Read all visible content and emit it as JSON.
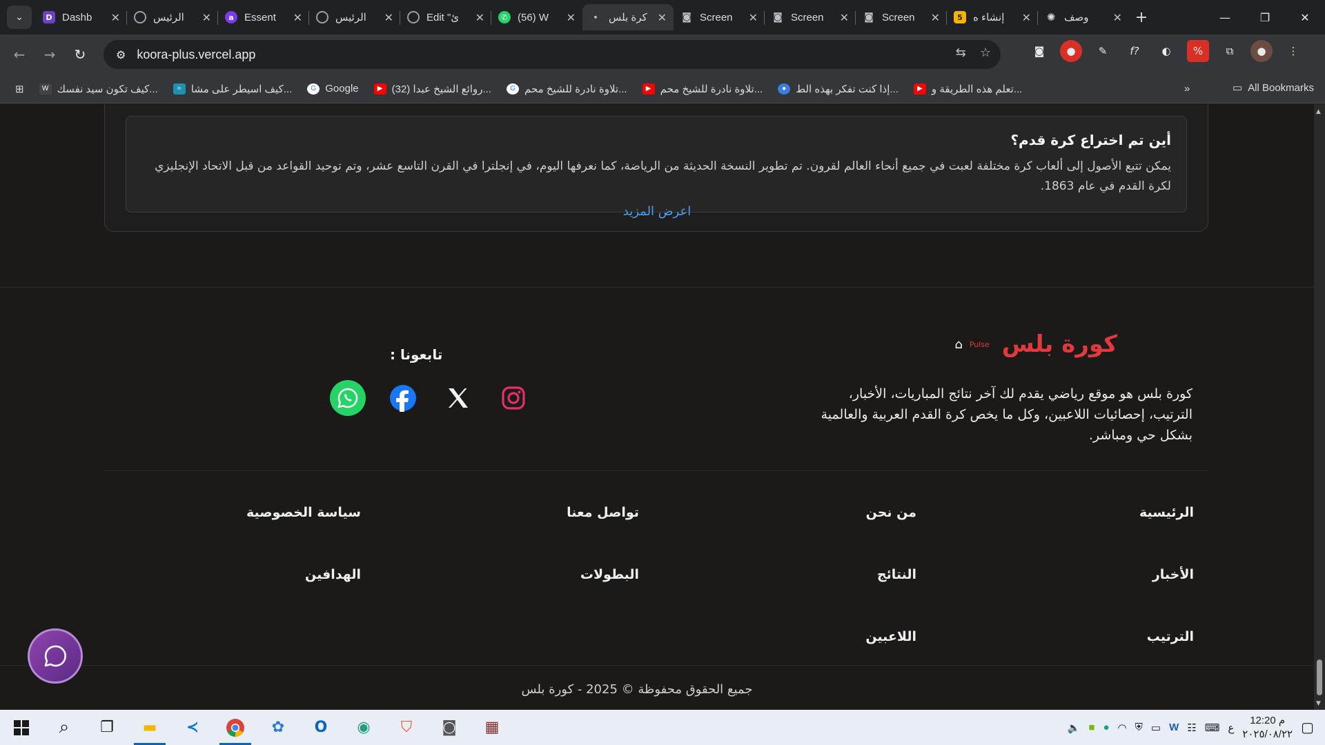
{
  "browser": {
    "tabs": [
      {
        "title": "Dashb",
        "icon": "dashboard-app-icon",
        "color": "#6f42c1"
      },
      {
        "title": "الرئيس",
        "icon": "globe-icon",
        "color": "#5f6368"
      },
      {
        "title": "Essent",
        "icon": "ai-app-icon",
        "color": "#7c3aed"
      },
      {
        "title": "الرئيس",
        "icon": "globe-icon",
        "color": "#5f6368"
      },
      {
        "title": "Edit \"ئ",
        "icon": "globe-icon",
        "color": "#5f6368"
      },
      {
        "title": "(56) W",
        "icon": "whatsapp-icon",
        "color": "#25d366"
      },
      {
        "title": "كرة بلس",
        "icon": "loading-icon",
        "color": "#35363a"
      },
      {
        "title": "Screen",
        "icon": "camera-icon",
        "color": "#5f6368"
      },
      {
        "title": "Screen",
        "icon": "camera-icon",
        "color": "#5f6368"
      },
      {
        "title": "Screen",
        "icon": "camera-icon",
        "color": "#5f6368"
      },
      {
        "title": "إنشاء ه",
        "icon": "five-icon",
        "color": "#f4b400"
      },
      {
        "title": "وصف",
        "icon": "chatgpt-icon",
        "color": "#5f6368"
      }
    ],
    "url": "koora-plus.vercel.app",
    "bookmarks": [
      {
        "title": "كيف تكون سيد نفسك...",
        "color": "#444"
      },
      {
        "title": "كيف اسيطر على مشا...",
        "color": "#1e90b0"
      },
      {
        "title": "Google",
        "color": "#ffffff"
      },
      {
        "title": "(32) روائع الشيخ عبدا...",
        "color": "#ff0000"
      },
      {
        "title": "تلاوة نادرة للشيخ محم...",
        "color": "#ffffff"
      },
      {
        "title": "تلاوة نادرة للشيخ محم...",
        "color": "#ff0000"
      },
      {
        "title": "إذا كنت تفكر بهذه الط...",
        "color": "#3c7ee0"
      },
      {
        "title": "تعلم هذه الطريقة و...",
        "color": "#ff0000"
      }
    ],
    "all_bookmarks": "All Bookmarks"
  },
  "page": {
    "faq": {
      "question": "أين تم اختراع كرة قدم؟",
      "answer": "يمكن تتبع الأصول إلى ألعاب كرة مختلفة لعبت في جميع أنحاء العالم لقرون. تم تطوير النسخة الحديثة من الرياضة، كما نعرفها اليوم، في إنجلترا في القرن التاسع عشر، وتم توحيد القواعد من قبل الاتحاد الإنجليزي لكرة القدم في عام 1863.",
      "show_more": "اعرض المزيد"
    },
    "footer": {
      "brand_name": "كورة بلس",
      "pulse_text": "Pulse",
      "about": "كورة بلس هو موقع رياضي يقدم لك آخر نتائج المباريات، الأخبار، الترتيب، إحصائيات اللاعبين، وكل ما يخص كرة القدم العربية والعالمية بشكل حي ومباشر.",
      "follow_us": "تابعونا :",
      "social": [
        "instagram-icon",
        "x-icon",
        "facebook-icon",
        "whatsapp-icon"
      ],
      "links": {
        "home": "الرئيسية",
        "about": "من نحن",
        "contact": "تواصل معنا",
        "privacy": "سياسة الخصوصية",
        "news": "الأخبار",
        "results": "النتائج",
        "tournaments": "البطولات",
        "scorers": "الهدافين",
        "standings": "الترتيب",
        "players": "اللاعبين"
      },
      "copyright": "جميع الحقوق محفوظة © 2025 - كورة بلس"
    }
  },
  "taskbar": {
    "apps": [
      "start-icon",
      "search-icon",
      "task-view-icon",
      "file-explorer-icon",
      "vscode-icon",
      "chrome-icon",
      "m365-icon",
      "outlook-icon",
      "edge-icon",
      "brave-icon",
      "camera-app-icon",
      "winrar-icon"
    ],
    "lang": "ع",
    "time": "12:20 م",
    "date": "٢٠٢٥/٠٨/٢٢"
  },
  "colors": {
    "accent": "#e0393e",
    "link": "#4a9fe8",
    "whatsapp": "#25d366",
    "facebook": "#1877f2",
    "instagram": "#e1306c"
  }
}
